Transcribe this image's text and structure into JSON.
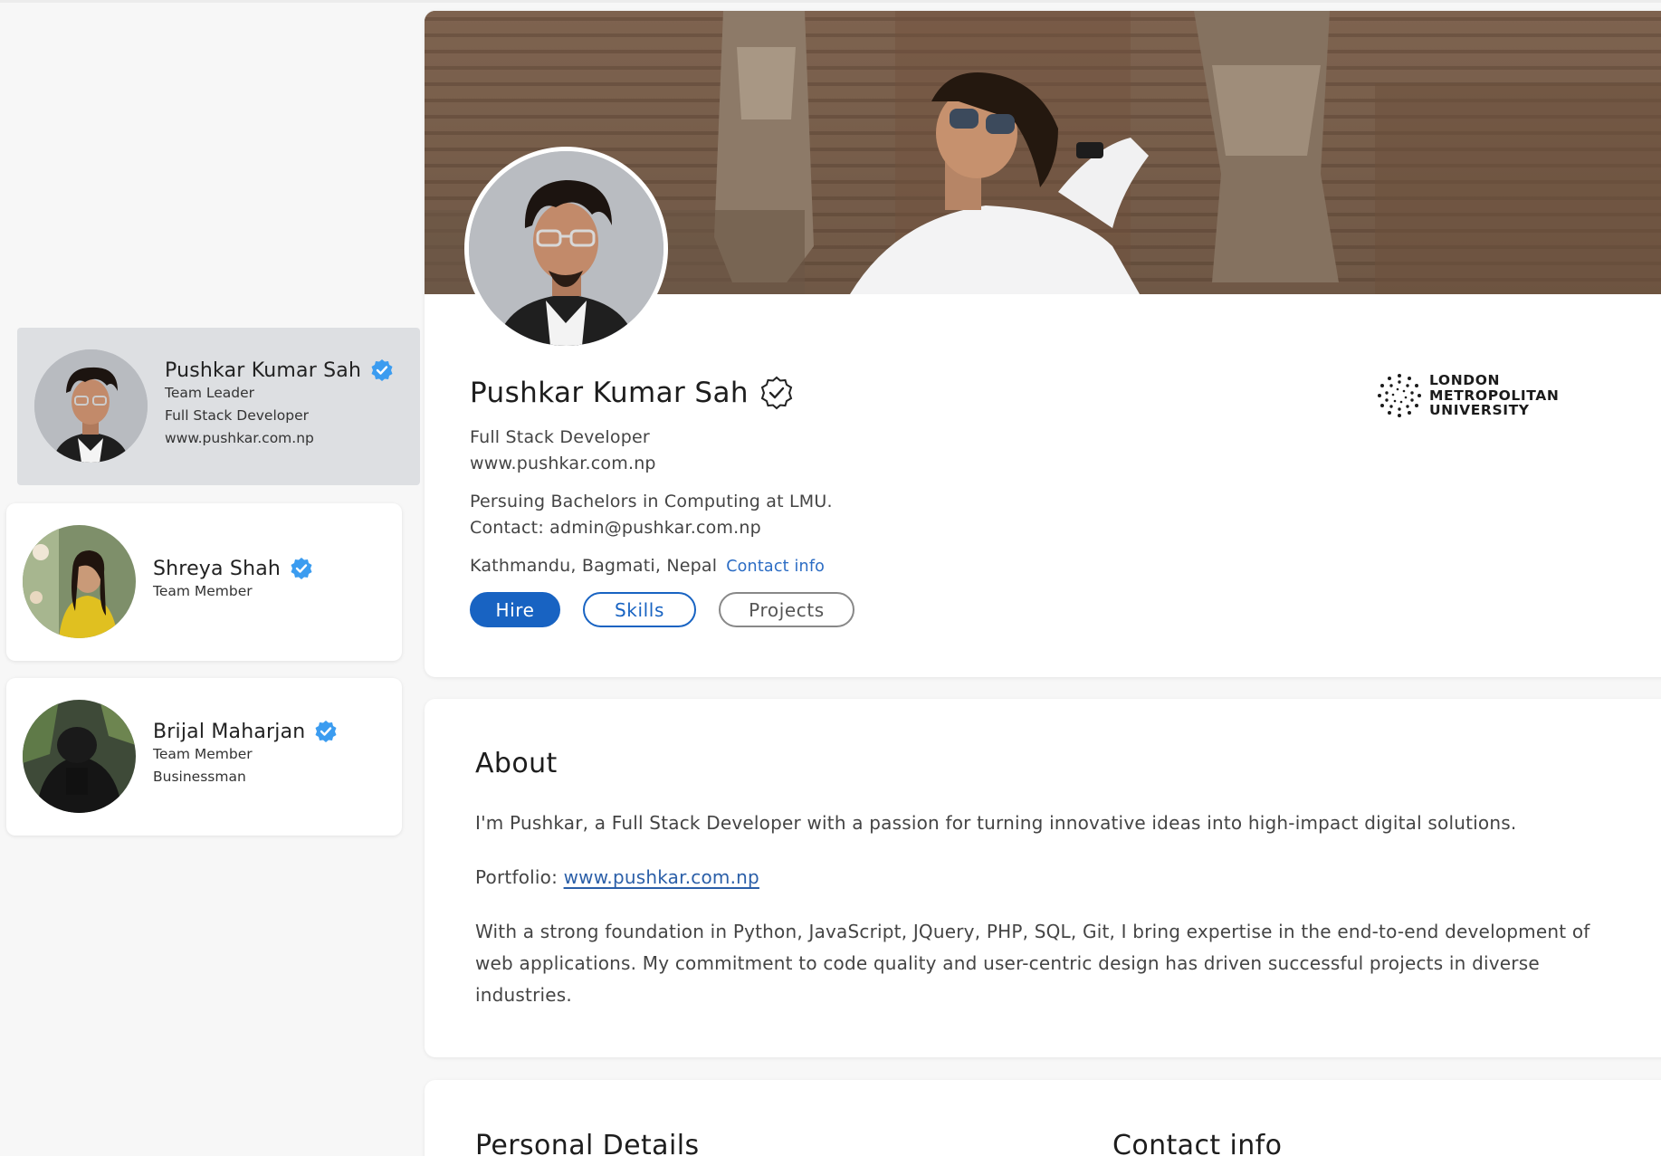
{
  "team": [
    {
      "name": "Pushkar Kumar Sah",
      "lines": [
        "Team Leader",
        "Full Stack Developer",
        "www.pushkar.com.np"
      ],
      "verified": true,
      "active": true
    },
    {
      "name": "Shreya Shah",
      "lines": [
        "Team Member"
      ],
      "verified": true,
      "active": false
    },
    {
      "name": "Brijal Maharjan",
      "lines": [
        "Team Member",
        "Businessman"
      ],
      "verified": true,
      "active": false
    }
  ],
  "profile": {
    "name": "Pushkar Kumar Sah",
    "title": "Full Stack Developer",
    "website": "www.pushkar.com.np",
    "education": "Persuing Bachelors in Computing at LMU.",
    "contact": "Contact: admin@pushkar.com.np",
    "location": "Kathmandu, Bagmati, Nepal",
    "contact_info_link": "Contact info",
    "buttons": {
      "hire": "Hire",
      "skills": "Skills",
      "projects": "Projects"
    },
    "university_logo_lines": [
      "LONDON",
      "METROPOLITAN",
      "UNIVERSITY"
    ]
  },
  "about": {
    "title": "About",
    "intro": "I'm Pushkar, a Full Stack Developer with a passion for turning innovative ideas into high-impact digital solutions.",
    "portfolio_label": "Portfolio:",
    "portfolio_url": "www.pushkar.com.np",
    "body": "With a strong foundation in Python, JavaScript, JQuery, PHP, SQL, Git, I bring expertise in the end-to-end development of web applications. My commitment to code quality and user-centric design has driven successful projects in diverse industries."
  },
  "details": {
    "personal_title": "Personal Details",
    "contact_title": "Contact info"
  },
  "colors": {
    "accent": "#1863c2",
    "verified": "#3b9cf0",
    "link": "#2b6cc4",
    "background": "#f7f7f7"
  }
}
